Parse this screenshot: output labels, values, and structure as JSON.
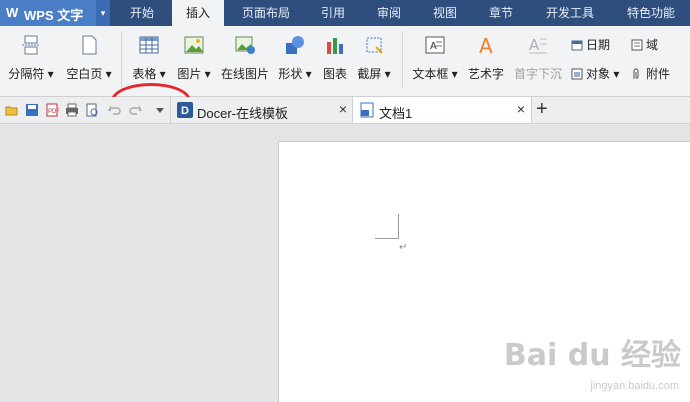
{
  "app": {
    "logo": "W",
    "title": "WPS 文字",
    "dropdown": "▾"
  },
  "menu_tabs": [
    "开始",
    "插入",
    "页面布局",
    "引用",
    "审阅",
    "视图",
    "章节",
    "开发工具",
    "特色功能"
  ],
  "ribbon": {
    "page_break": "分隔符",
    "blank_page": "空白页",
    "table": "表格",
    "picture": "图片",
    "online_picture": "在线图片",
    "shape": "形状",
    "chart": "图表",
    "screenshot": "截屏",
    "text_box": "文本框",
    "word_art": "艺术字",
    "drop_cap": "首字下沉",
    "date": "日期",
    "object": "对象",
    "field": "域",
    "attachment": "附件"
  },
  "doc_tabs": [
    {
      "label": "Docer-在线模板"
    },
    {
      "label": "文档1"
    }
  ],
  "new_tab_label": "+",
  "close_label": "×",
  "paragraph_mark": "↵",
  "watermark": {
    "brand": "Bai du 经验",
    "url": "jingyan.baidu.com"
  },
  "colors": {
    "title_bar": "#2e4e7e",
    "app_button": "#4a7fc8",
    "annotation": "#e3262f"
  }
}
